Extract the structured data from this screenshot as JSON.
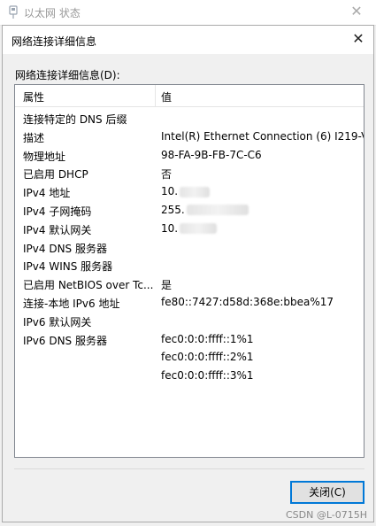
{
  "background_window": {
    "title": "以太网 状态",
    "close_glyph": "✕"
  },
  "dialog": {
    "title": "网络连接详细信息",
    "close_glyph": "✕",
    "section_label": "网络连接详细信息(D):",
    "columns": {
      "property": "属性",
      "value": "值"
    },
    "rows": [
      {
        "property": "连接特定的 DNS 后缀",
        "value": ""
      },
      {
        "property": "描述",
        "value": "Intel(R) Ethernet Connection (6) I219-V"
      },
      {
        "property": "物理地址",
        "value": "98-FA-9B-FB-7C-C6"
      },
      {
        "property": "已启用 DHCP",
        "value": "否"
      },
      {
        "property": "IPv4 地址",
        "value": "10."
      },
      {
        "property": "IPv4 子网掩码",
        "value": "255."
      },
      {
        "property": "IPv4 默认网关",
        "value": "10."
      },
      {
        "property": "IPv4 DNS 服务器",
        "value": ""
      },
      {
        "property": "IPv4 WINS 服务器",
        "value": ""
      },
      {
        "property": "已启用 NetBIOS over Tc...",
        "value": "是"
      },
      {
        "property": "连接-本地 IPv6 地址",
        "value": "fe80::7427:d58d:368e:bbea%17"
      },
      {
        "property": "IPv6 默认网关",
        "value": ""
      },
      {
        "property": "IPv6 DNS 服务器",
        "value": "fec0:0:0:ffff::1%1"
      },
      {
        "property": "",
        "value": "fec0:0:0:ffff::2%1"
      },
      {
        "property": "",
        "value": "fec0:0:0:ffff::3%1"
      }
    ],
    "close_button_label": "关闭(C)"
  },
  "watermark": "CSDN @L-0715H",
  "colors": {
    "accent": "#0078d7",
    "window_bg": "#f0f0f0",
    "list_border": "#828790"
  }
}
